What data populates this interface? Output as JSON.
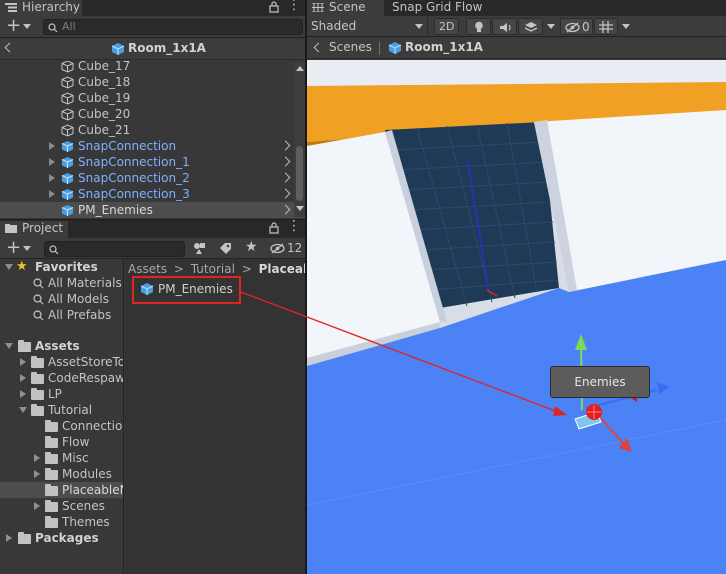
{
  "hierarchy": {
    "tab": "Hierarchy",
    "search_placeholder": "All",
    "breadcrumb": "Room_1x1A",
    "items": [
      {
        "label": "Cube_17"
      },
      {
        "label": "Cube_18"
      },
      {
        "label": "Cube_19"
      },
      {
        "label": "Cube_20"
      },
      {
        "label": "Cube_21"
      },
      {
        "label": "SnapConnection"
      },
      {
        "label": "SnapConnection_1"
      },
      {
        "label": "SnapConnection_2"
      },
      {
        "label": "SnapConnection_3"
      },
      {
        "label": "PM_Enemies"
      }
    ]
  },
  "scene": {
    "tabs": [
      {
        "label": "Scene"
      },
      {
        "label": "Snap Grid Flow"
      }
    ],
    "shading": "Shaded",
    "mode_2d": "2D",
    "hidden_count": "0",
    "breadcrumb": {
      "root": "Scenes",
      "current": "Room_1x1A"
    },
    "tooltip": "Enemies"
  },
  "project": {
    "tab": "Project",
    "badge_count": "12",
    "favorites": {
      "label": "Favorites",
      "items": [
        "All Materials",
        "All Models",
        "All Prefabs"
      ]
    },
    "assets": {
      "label": "Assets",
      "items": [
        "AssetStoreTo",
        "CodeRespaw",
        "LP",
        "Tutorial",
        "Connection",
        "Flow",
        "Misc",
        "Modules",
        "PlaceableM",
        "Scenes",
        "Themes"
      ]
    },
    "packages": "Packages",
    "path": [
      "Assets",
      ">",
      "Tutorial",
      ">",
      "PlaceableM"
    ],
    "asset_file": "PM_Enemies"
  },
  "colors": {
    "accent_orange": "#f0a022",
    "ground_blue": "#4b82f5",
    "selection_red": "#e02424",
    "link_blue": "#7cb2ff"
  }
}
